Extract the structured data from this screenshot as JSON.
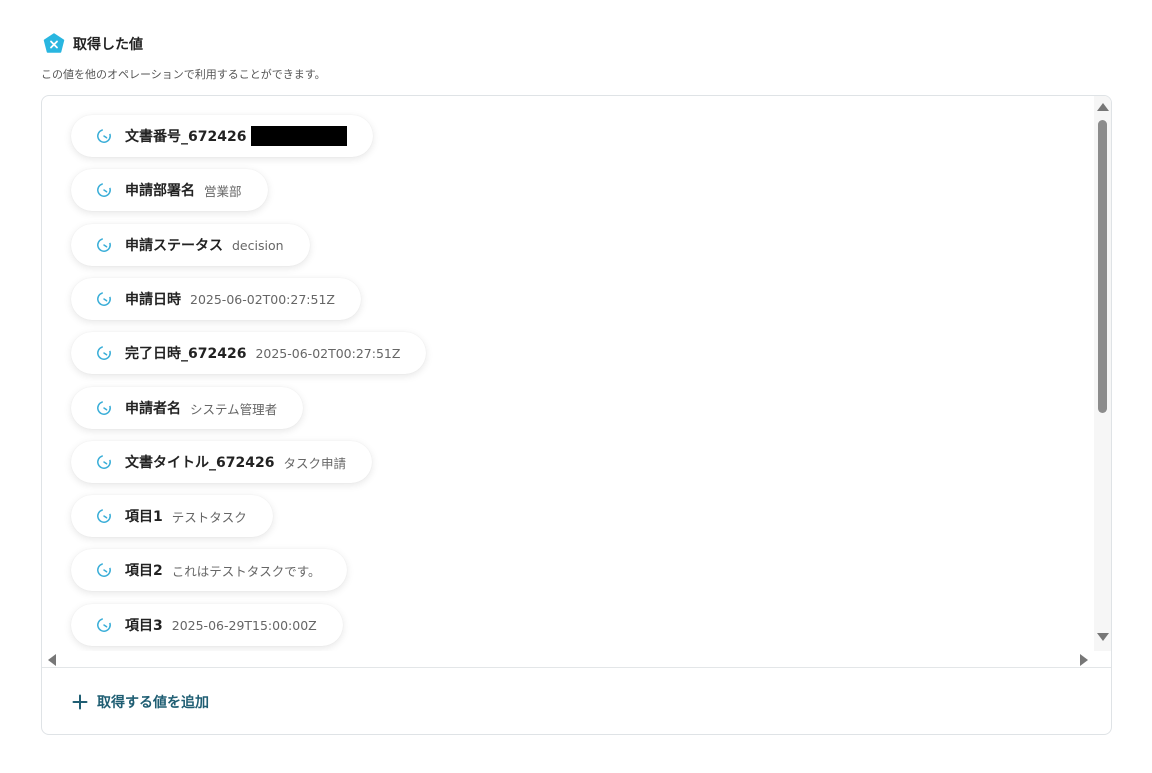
{
  "header": {
    "title": "取得した値",
    "icon": "x-badge-icon",
    "accent": "#29b6e0"
  },
  "subtitle": "この値を他のオペレーションで利用することができます。",
  "items": [
    {
      "label": "文書番号_672426",
      "value": "",
      "redacted": true
    },
    {
      "label": "申請部署名",
      "value": "営業部"
    },
    {
      "label": "申請ステータス",
      "value": "decision"
    },
    {
      "label": "申請日時",
      "value": "2025-06-02T00:27:51Z"
    },
    {
      "label": "完了日時_672426",
      "value": "2025-06-02T00:27:51Z"
    },
    {
      "label": "申請者名",
      "value": "システム管理者"
    },
    {
      "label": "文書タイトル_672426",
      "value": "タスク申請"
    },
    {
      "label": "項目1",
      "value": "テストタスク"
    },
    {
      "label": "項目2",
      "value": "これはテストタスクです。"
    },
    {
      "label": "項目3",
      "value": "2025-06-29T15:00:00Z"
    }
  ],
  "item_icon": "clock-icon",
  "add_button": {
    "label": "取得する値を追加",
    "color": "#1f5e73"
  }
}
